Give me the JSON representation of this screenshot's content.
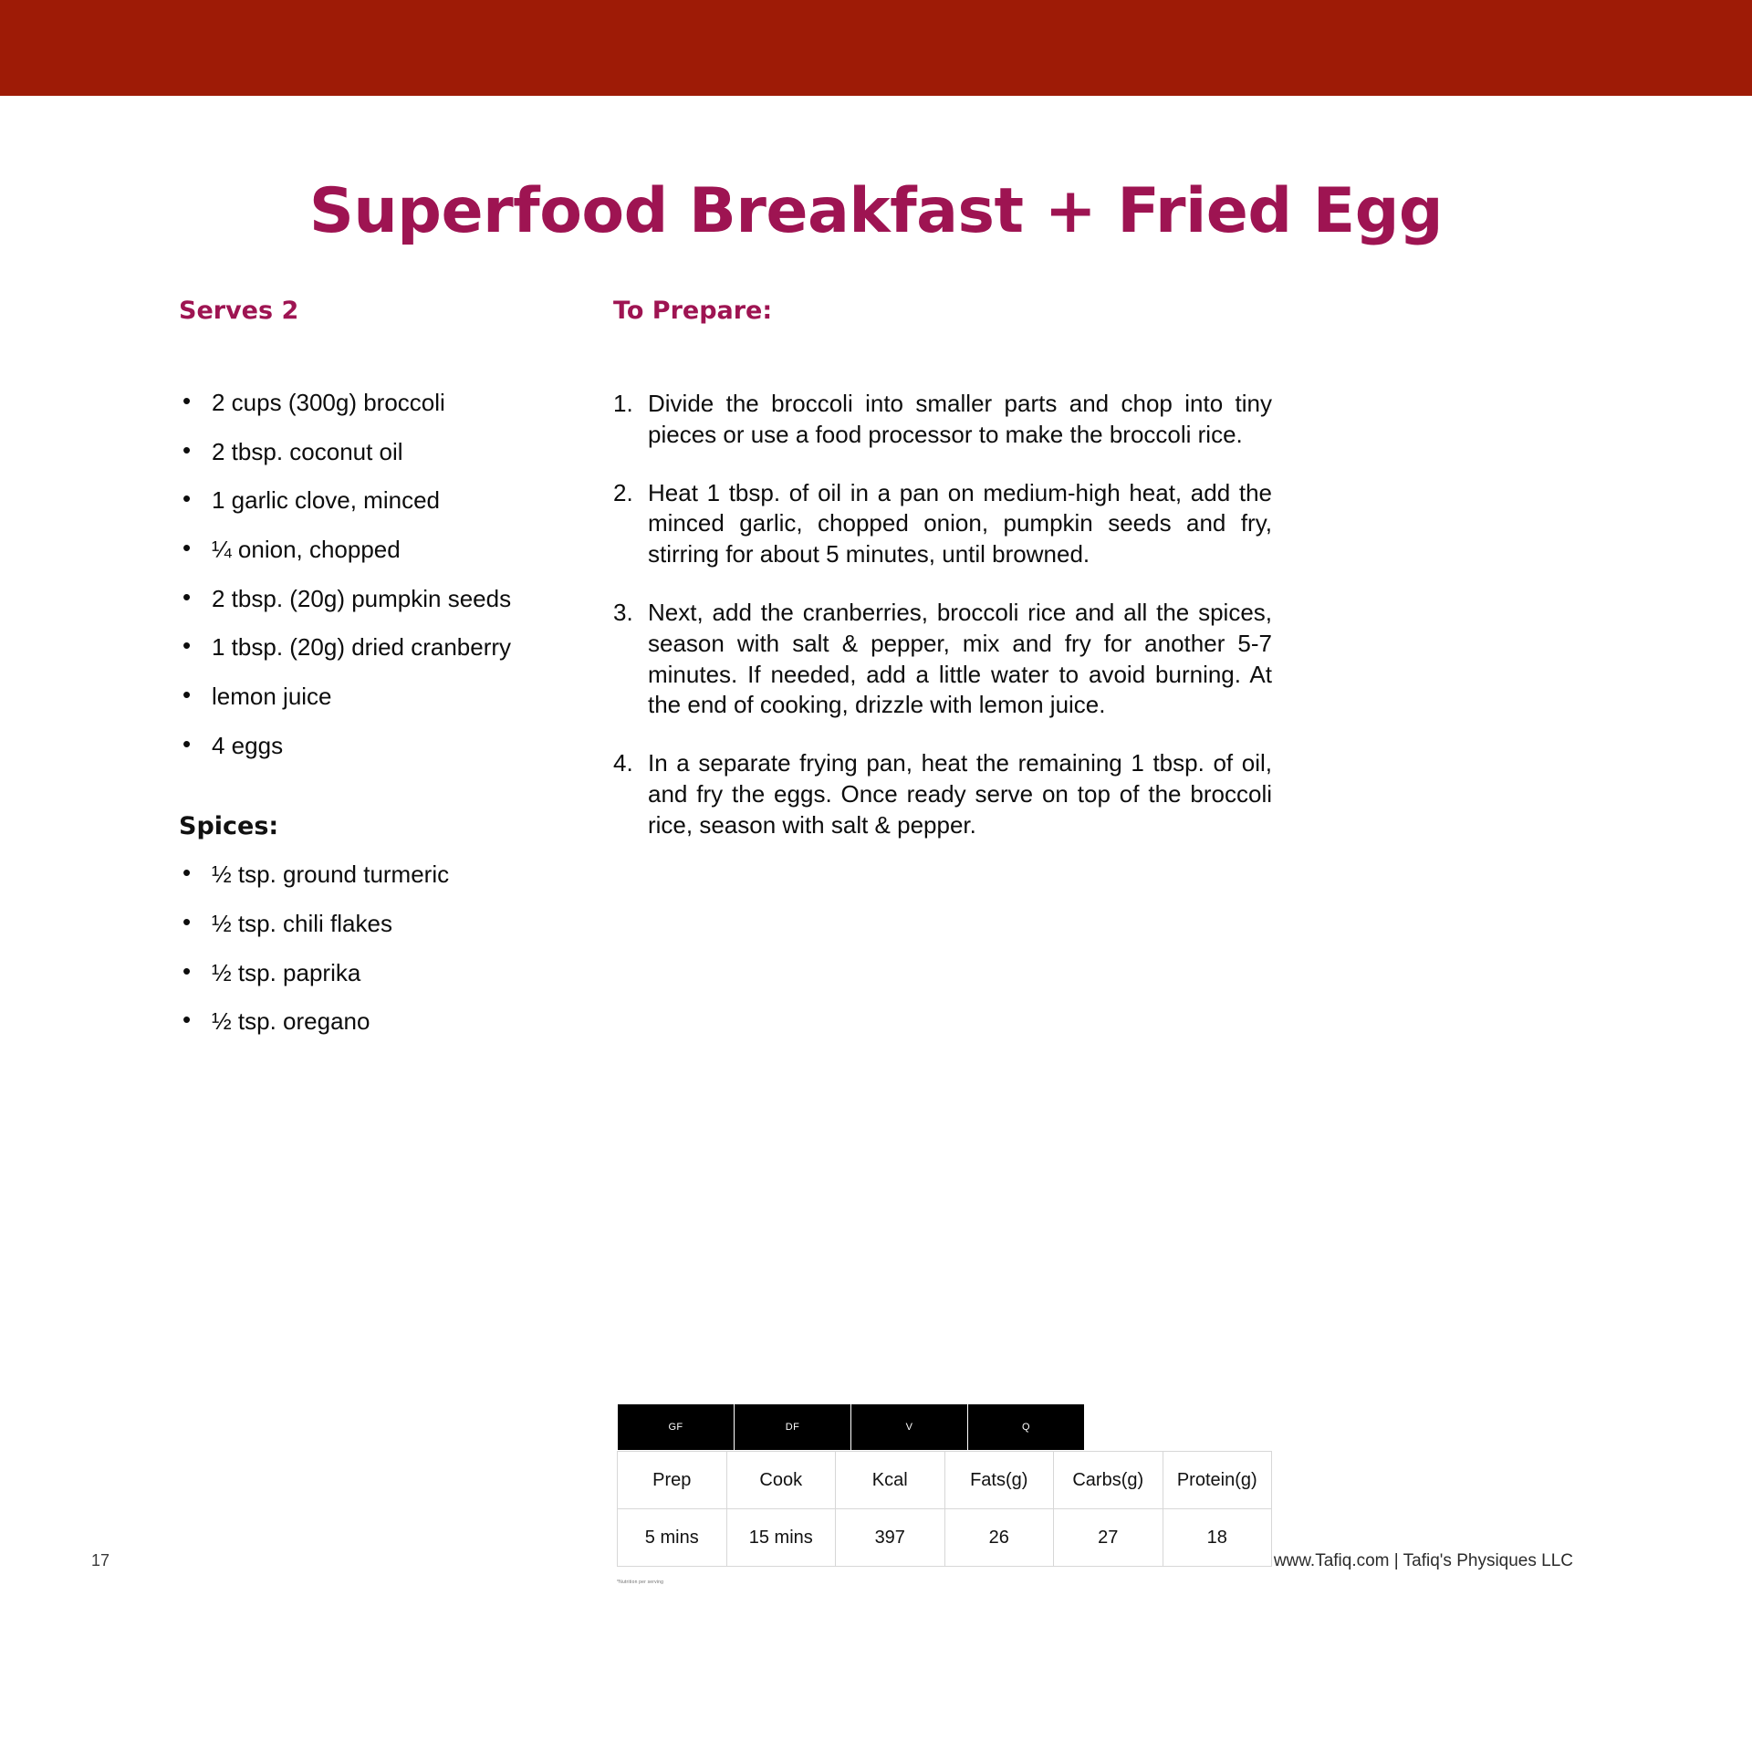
{
  "banner": {
    "color": "#9e1b06"
  },
  "accent_color": "#9e1452",
  "title": "Superfood Breakfast + Fried Egg",
  "left_column": {
    "serves_heading": "Serves 2",
    "ingredients": [
      "2 cups (300g) broccoli",
      "2 tbsp. coconut oil",
      "1 garlic clove, minced",
      "¼ onion, chopped",
      "2 tbsp. (20g) pumpkin seeds",
      "1 tbsp. (20g) dried cranberry",
      "lemon juice",
      "4 eggs"
    ],
    "spices_heading": "Spices:",
    "spices": [
      "½ tsp. ground turmeric",
      "½ tsp. chili flakes",
      "½ tsp. paprika",
      "½ tsp. oregano"
    ]
  },
  "right_column": {
    "prepare_heading": "To Prepare:",
    "steps": [
      {
        "num": "1.",
        "text": "Divide the broccoli into smaller parts and chop into tiny pieces or use a food processor to make the broccoli rice."
      },
      {
        "num": "2.",
        "text": "Heat 1 tbsp. of oil in a pan on medium-high heat, add the minced garlic, chopped onion, pumpkin seeds and fry, stirring for about 5 minutes, until browned."
      },
      {
        "num": "3.",
        "text": "Next, add the cranberries, broccoli rice and all the spices, season with salt & pepper, mix and fry for another 5-7 minutes. If needed, add a little water to avoid burning. At the end of cooking, drizzle with lemon juice."
      },
      {
        "num": "4.",
        "text": "In a separate frying pan, heat the remaining 1 tbsp. of oil, and fry the eggs. Once ready serve on top of the broccoli rice, season with salt & pepper."
      }
    ]
  },
  "nutrition": {
    "tags": [
      "GF",
      "DF",
      "V",
      "Q"
    ],
    "headers": [
      "Prep",
      "Cook",
      "Kcal",
      "Fats(g)",
      "Carbs(g)",
      "Protein(g)"
    ],
    "values": [
      "5 mins",
      "15 mins",
      "397",
      "26",
      "27",
      "18"
    ],
    "note": "*Nutrition per serving"
  },
  "footer": {
    "page_number": "17",
    "site_credit": "www.Tafiq.com  |  Tafiq's Physiques LLC"
  }
}
